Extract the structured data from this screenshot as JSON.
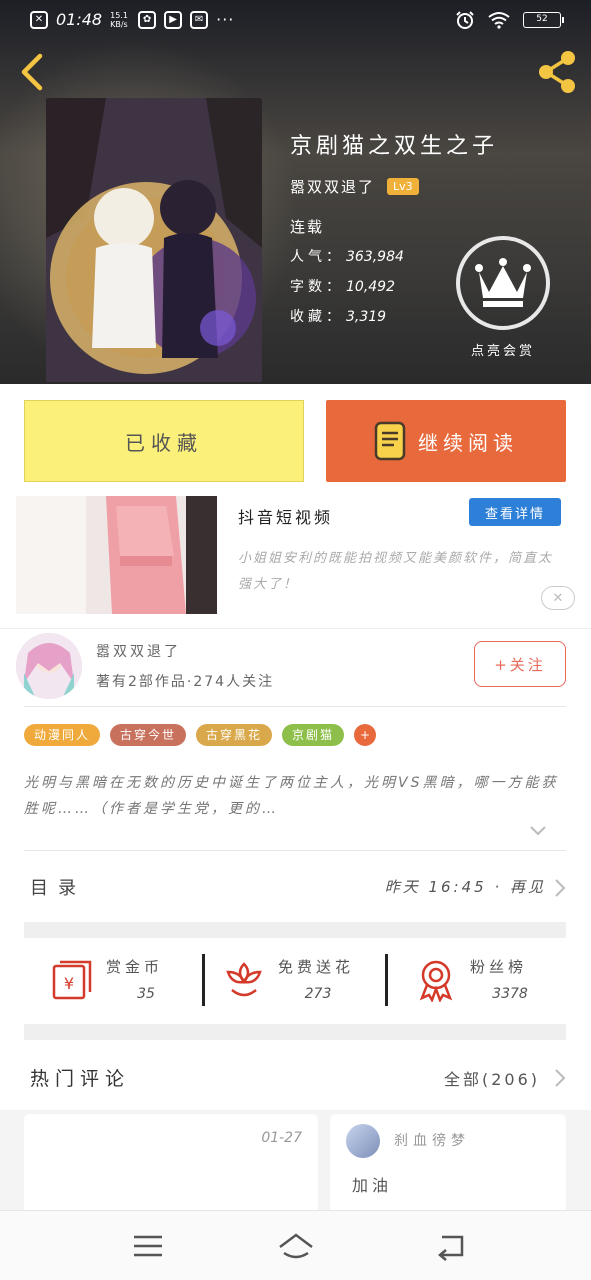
{
  "status_bar": {
    "time": "01:48",
    "net_speed": "15.1 KB/s",
    "battery": "52",
    "overflow_dots": "···"
  },
  "book": {
    "title": "京剧猫之双生之子",
    "author": "嚣双双退了",
    "author_level": "Lv3",
    "serial_status": "连载",
    "popularity_label": "人气：",
    "popularity": "363,984",
    "word_count_label": "字数：",
    "word_count": "10,492",
    "collections_label": "收藏：",
    "collections": "3,319",
    "award_label": "点亮会赏"
  },
  "actions": {
    "collected_label": "已收藏",
    "read_label": "继续阅读"
  },
  "ad": {
    "title": "抖音短视频",
    "detail_button": "查看详情",
    "description": "小姐姐安利的既能拍视频又能美颜软件，简直太强大了！",
    "close_icon": "close-icon"
  },
  "author_card": {
    "name": "嚣双双退了",
    "works_text": "著有2部作品·274人关注",
    "follow_label": "+关注"
  },
  "tags": [
    {
      "label": "动漫同人",
      "color": "#f0a93b"
    },
    {
      "label": "古穿今世",
      "color": "#c8725e"
    },
    {
      "label": "古穿黑花",
      "color": "#d9a84a"
    },
    {
      "label": "京剧猫",
      "color": "#8dbf4a"
    },
    {
      "label": "+",
      "color": "#e8693c"
    }
  ],
  "synopsis": "光明与黑暗在无数的历史中诞生了两位主人，光明VS黑暗，哪一方能获胜呢……（作者是学生党，更的…",
  "toc": {
    "label": "目录",
    "last_update": "昨天 16:45 · 再见"
  },
  "support": [
    {
      "label": "赏金币",
      "value": "35",
      "icon": "red-envelope-icon"
    },
    {
      "label": "免费送花",
      "value": "273",
      "icon": "flower-icon"
    },
    {
      "label": "粉丝榜",
      "value": "3378",
      "icon": "medal-icon"
    }
  ],
  "hot_comments": {
    "label": "热门评论",
    "count_label": "全部(206)"
  },
  "comments": [
    {
      "date": "01-27",
      "user": "",
      "text": ""
    },
    {
      "date": "",
      "user": "刹血徬梦",
      "text": "加油"
    }
  ],
  "colors": {
    "accent_orange": "#e8693c",
    "collected_yellow": "#fbf07a",
    "level_badge": "#f0b13a",
    "ad_button_blue": "#2d7fd8",
    "follow_red": "#e86a5a"
  }
}
